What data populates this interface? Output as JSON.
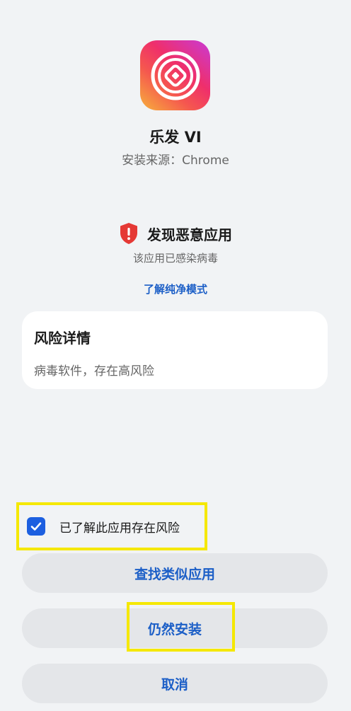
{
  "app": {
    "name": "乐发 VI",
    "source": "安装来源：Chrome",
    "icon": "app-logo-icon"
  },
  "warning": {
    "title": "发现恶意应用",
    "subtitle": "该应用已感染病毒",
    "link": "了解纯净模式",
    "icon": "shield-alert-icon"
  },
  "risk": {
    "title": "风险详情",
    "description": "病毒软件，存在高风险"
  },
  "acknowledge": {
    "label": "已了解此应用存在风险",
    "checked": true
  },
  "buttons": {
    "find_similar": "查找类似应用",
    "install_anyway": "仍然安装",
    "cancel": "取消"
  },
  "colors": {
    "accent": "#1c5fc7",
    "danger": "#e53935",
    "highlight": "#f5e800"
  }
}
